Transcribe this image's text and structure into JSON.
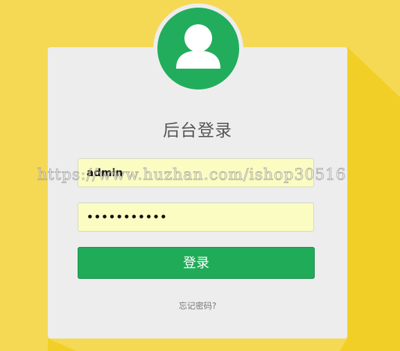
{
  "page": {
    "title": "后台登录",
    "background_color": "#f5d955",
    "accent_color": "#20ab58"
  },
  "avatar": {
    "icon": "user-icon"
  },
  "form": {
    "username_value": "admin",
    "password_value": "•••••••••••",
    "login_label": "登录",
    "forgot_label": "忘记密码?"
  },
  "watermark": {
    "text": "https://www.huzhan.com/ishop30516"
  }
}
